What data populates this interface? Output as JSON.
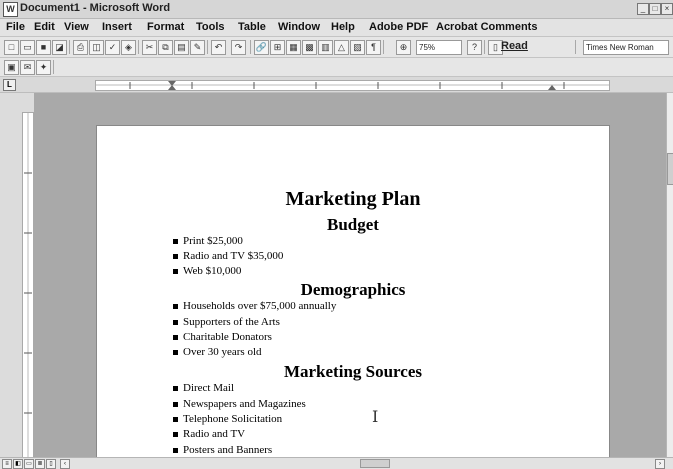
{
  "window": {
    "title": "Document1 - Microsoft Word",
    "app_icon": "word-doc-icon"
  },
  "menu": {
    "items": [
      "File",
      "Edit",
      "View",
      "Insert",
      "Format",
      "Tools",
      "Table",
      "Window",
      "Help",
      "Adobe PDF",
      "Acrobat Comments"
    ]
  },
  "toolbar": {
    "zoom_value": "75%",
    "read_label": "Read",
    "font_name": "Times New Roman"
  },
  "document": {
    "title": "Marketing Plan",
    "sections": [
      {
        "heading": "Budget",
        "items": [
          "Print $25,000",
          "Radio and TV $35,000",
          "Web $10,000"
        ]
      },
      {
        "heading": "Demographics",
        "items": [
          "Households over $75,000 annually",
          "Supporters of the Arts",
          "Charitable Donators",
          "Over 30 years old"
        ]
      },
      {
        "heading": "Marketing Sources",
        "items": [
          "Direct Mail",
          "Newspapers and Magazines",
          "Telephone Solicitation",
          "Radio and TV",
          "Posters and Banners"
        ]
      }
    ]
  }
}
